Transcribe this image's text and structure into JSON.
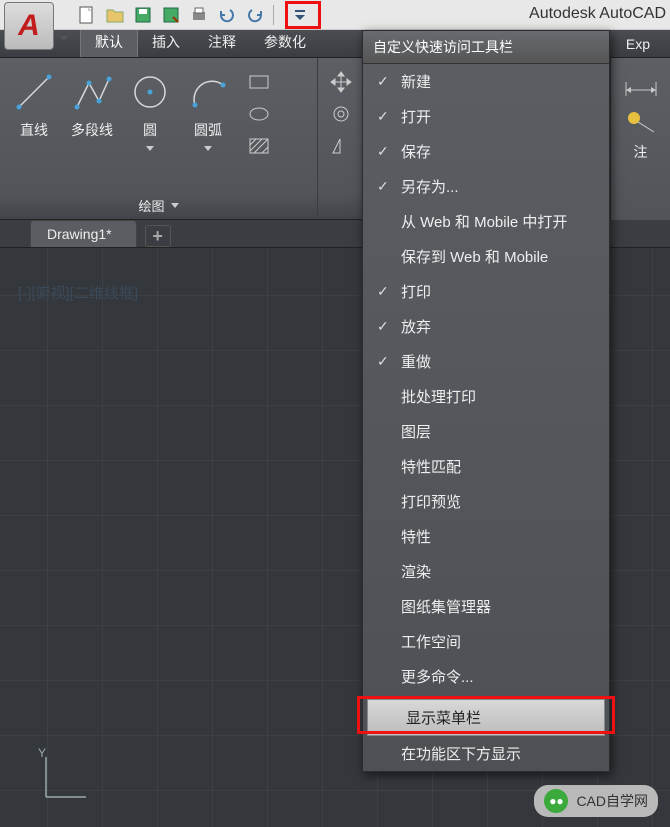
{
  "app": {
    "title": "Autodesk AutoCAD",
    "logo_letter": "A"
  },
  "qat": {
    "dropdown_tooltip": "自定义快速访问工具栏"
  },
  "ribbon_tabs": {
    "active": "默认",
    "items": [
      "默认",
      "插入",
      "注释",
      "参数化"
    ],
    "extra": "Exp"
  },
  "ribbon": {
    "draw": {
      "line": "直线",
      "polyline": "多段线",
      "circle": "圆",
      "arc": "圆弧",
      "panel_title": "绘图"
    },
    "right_frag_label": "注"
  },
  "doc": {
    "tab_name": "Drawing1*",
    "view_label": "[-][俯视][二维线框]"
  },
  "dropdown": {
    "title": "自定义快速访问工具栏",
    "items": [
      {
        "label": "新建",
        "checked": true
      },
      {
        "label": "打开",
        "checked": true
      },
      {
        "label": "保存",
        "checked": true
      },
      {
        "label": "另存为...",
        "checked": true
      },
      {
        "label": "从 Web 和 Mobile 中打开",
        "checked": false
      },
      {
        "label": "保存到 Web 和 Mobile",
        "checked": false
      },
      {
        "label": "打印",
        "checked": true
      },
      {
        "label": "放弃",
        "checked": true
      },
      {
        "label": "重做",
        "checked": true
      },
      {
        "label": "批处理打印",
        "checked": false
      },
      {
        "label": "图层",
        "checked": false
      },
      {
        "label": "特性匹配",
        "checked": false
      },
      {
        "label": "打印预览",
        "checked": false
      },
      {
        "label": "特性",
        "checked": false
      },
      {
        "label": "渲染",
        "checked": false
      },
      {
        "label": "图纸集管理器",
        "checked": false
      },
      {
        "label": "工作空间",
        "checked": false
      },
      {
        "label": "更多命令...",
        "checked": false
      }
    ],
    "hl_item": "显示菜单栏",
    "last_item": "在功能区下方显示"
  },
  "watermark": {
    "text": "CAD自学网"
  }
}
